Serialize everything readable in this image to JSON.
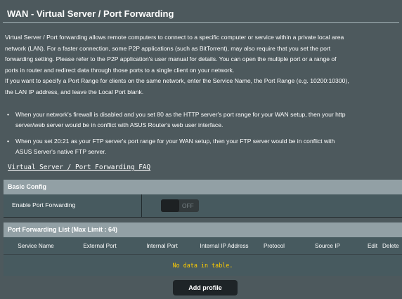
{
  "page": {
    "title": "WAN - Virtual Server / Port Forwarding",
    "description": [
      "Virtual Server / Port forwarding allows remote computers to connect to a specific computer or service within a private local area",
      "network (LAN). For a faster connection, some P2P applications (such as BitTorrent), may also require that you set the port",
      "forwarding setting. Please refer to the P2P application's user manual for details. You can open the multiple port or a range of",
      "ports in router and redirect data through those ports to a single client on your network.",
      "If you want to specify a Port Range for clients on the same network, enter the Service Name, the Port Range (e.g. 10200:10300),",
      "the LAN IP address, and leave the Local Port blank."
    ],
    "bullets": [
      {
        "line1": "When your network's firewall is disabled and you set 80 as the HTTP server's port range for your WAN setup, then your http",
        "line2": "server/web server would be in conflict with ASUS Router's web user interface."
      },
      {
        "line1": "When you set 20:21 as your FTP server's port range for your WAN setup, then your FTP server would be in conflict with",
        "line2": "ASUS Server's native FTP server."
      }
    ],
    "bullet_glyph": "•",
    "faq_link": "Virtual Server / Port Forwarding FAQ"
  },
  "basic_config": {
    "header": "Basic Config",
    "enable_label": "Enable Port Forwarding",
    "toggle_state": "OFF"
  },
  "port_forwarding_list": {
    "header": "Port Forwarding List (Max Limit : 64)",
    "columns": [
      "Service Name",
      "External Port",
      "Internal Port",
      "Internal IP Address",
      "Protocol",
      "Source IP",
      "Edit",
      "Delete"
    ],
    "empty_message": "No data in table.",
    "add_button": "Add profile"
  },
  "colors": {
    "background": "#4d595d",
    "section_header": "#92a0a5",
    "row_background": "#475a5f",
    "no_data_text": "#ffcc00",
    "button": "#1e2427"
  }
}
